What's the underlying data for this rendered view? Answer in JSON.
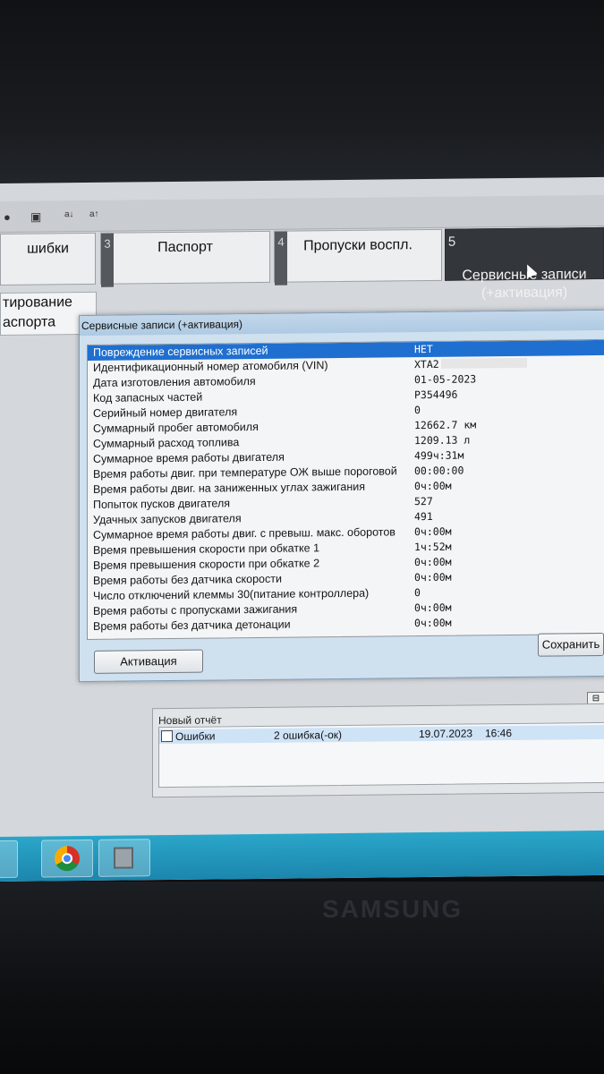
{
  "tabs": [
    {
      "num": "",
      "label": "шибки"
    },
    {
      "num": "3",
      "label": "Паспорт"
    },
    {
      "num": "4",
      "label": "Пропуски воспл."
    },
    {
      "num": "5",
      "label": "Сервисные записи\n(+активация)"
    }
  ],
  "subtab": {
    "label": "тирование\nаспорта"
  },
  "dialog": {
    "title": "Сервисные записи (+активация)",
    "rows": [
      {
        "label": "Повреждение сервисных записей",
        "value": "НЕТ"
      },
      {
        "label": "Идентификационный номер атомобиля (VIN)",
        "value": "XTA2"
      },
      {
        "label": "Дата изготовления автомобиля",
        "value": "01-05-2023"
      },
      {
        "label": "Код запасных частей",
        "value": "P354496"
      },
      {
        "label": "Серийный номер двигателя",
        "value": "0"
      },
      {
        "label": "Суммарный пробег автомобиля",
        "value": "12662.7 км"
      },
      {
        "label": "Суммарный расход топлива",
        "value": "1209.13 л"
      },
      {
        "label": "Суммарное время работы двигателя",
        "value": "499ч:31м"
      },
      {
        "label": "Время работы двиг. при температуре ОЖ выше пороговой",
        "value": "00:00:00"
      },
      {
        "label": "Время работы двиг. на заниженных углах зажигания",
        "value": "0ч:00м"
      },
      {
        "label": "Попыток пусков двигателя",
        "value": "527"
      },
      {
        "label": "Удачных запусков двигателя",
        "value": "491"
      },
      {
        "label": "Суммарное время работы двиг. с превыш. макс. оборотов",
        "value": "0ч:00м"
      },
      {
        "label": "Время превышения скорости при обкатке 1",
        "value": "1ч:52м"
      },
      {
        "label": "Время превышения скорости при обкатке 2",
        "value": "0ч:00м"
      },
      {
        "label": "Время работы без датчика скорости",
        "value": "0ч:00м"
      },
      {
        "label": "Число отключений клеммы 30(питание контроллера)",
        "value": "0"
      },
      {
        "label": "Время работы с пропусками зажигания",
        "value": "0ч:00м"
      },
      {
        "label": "Время работы без датчика детонации",
        "value": "0ч:00м"
      }
    ],
    "activate_label": "Активация",
    "save_label": "Сохранить"
  },
  "report": {
    "title": "Новый отчёт",
    "row": {
      "name": "Ошибки",
      "count": "2 ошибка(-ок)",
      "date": "19.07.2023",
      "time": "16:46"
    }
  },
  "icons": [
    "record-icon",
    "save-icon",
    "font-a-icon",
    "font-a-icon",
    "chrome-icon",
    "app-icon"
  ],
  "colors": {
    "selection": "#1f6fd0",
    "active_tab": "#33373c",
    "taskbar": "#1c86ad"
  },
  "brand": "SAMSUNG"
}
